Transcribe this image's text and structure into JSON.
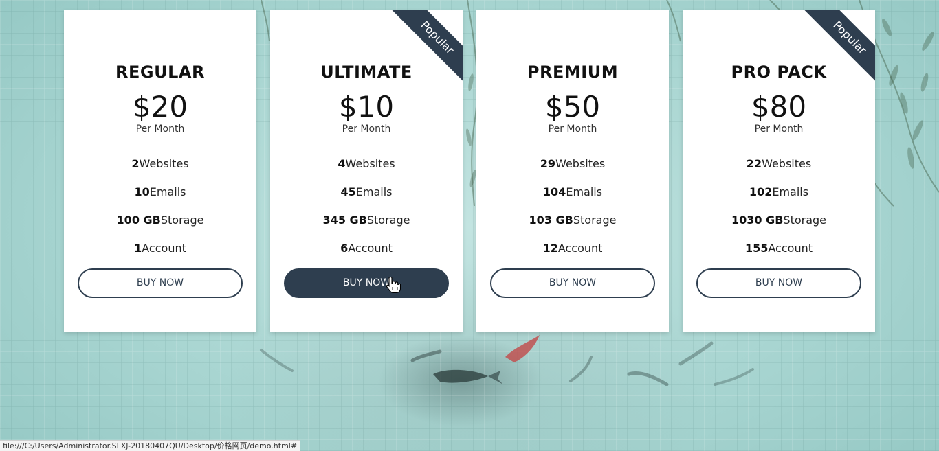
{
  "plans": [
    {
      "name": "REGULAR",
      "price": "$20",
      "period": "Per Month",
      "popular": false,
      "features": [
        {
          "value": "2",
          "label": "Websites"
        },
        {
          "value": "10",
          "label": "Emails"
        },
        {
          "value": "100 GB",
          "label": "Storage"
        },
        {
          "value": "1",
          "label": "Account"
        }
      ],
      "button": "BUY NOW"
    },
    {
      "name": "ULTIMATE",
      "price": "$10",
      "period": "Per Month",
      "popular": true,
      "ribbon": "Popular",
      "features": [
        {
          "value": "4",
          "label": "Websites"
        },
        {
          "value": "45",
          "label": "Emails"
        },
        {
          "value": "345 GB",
          "label": "Storage"
        },
        {
          "value": "6",
          "label": "Account"
        }
      ],
      "button": "BUY NOW"
    },
    {
      "name": "PREMIUM",
      "price": "$50",
      "period": "Per Month",
      "popular": false,
      "features": [
        {
          "value": "29",
          "label": "Websites"
        },
        {
          "value": "104",
          "label": "Emails"
        },
        {
          "value": "103 GB",
          "label": "Storage"
        },
        {
          "value": "12",
          "label": "Account"
        }
      ],
      "button": "BUY NOW"
    },
    {
      "name": "PRO PACK",
      "price": "$80",
      "period": "Per Month",
      "popular": true,
      "ribbon": "Popular",
      "features": [
        {
          "value": "22",
          "label": "Websites"
        },
        {
          "value": "102",
          "label": "Emails"
        },
        {
          "value": "1030 GB",
          "label": "Storage"
        },
        {
          "value": "155",
          "label": "Account"
        }
      ],
      "button": "BUY NOW"
    }
  ],
  "status_bar": {
    "url": "file:///C:/Users/Administrator.SLXJ-20180407QU/Desktop/价格网页/demo.html#"
  },
  "colors": {
    "accent": "#2e3e4f",
    "card": "#ffffff",
    "background": "#a9d6d2"
  },
  "icons": {
    "cursor": "hand-pointer-icon"
  }
}
